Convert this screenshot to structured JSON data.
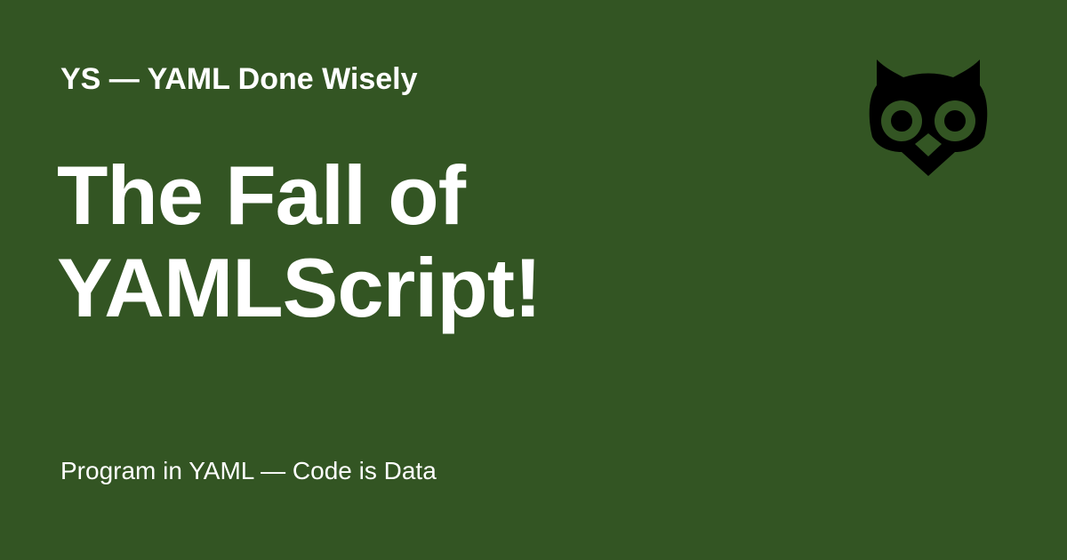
{
  "card": {
    "site_title": "YS — YAML Done Wisely",
    "title_lines": [
      "The Fall of",
      "YAMLScript!"
    ],
    "tagline": "Program in YAML — Code is Data",
    "logo_icon": "owl-icon"
  },
  "colors": {
    "background": "#335523",
    "text": "#ffffff",
    "logo": "#000000"
  }
}
